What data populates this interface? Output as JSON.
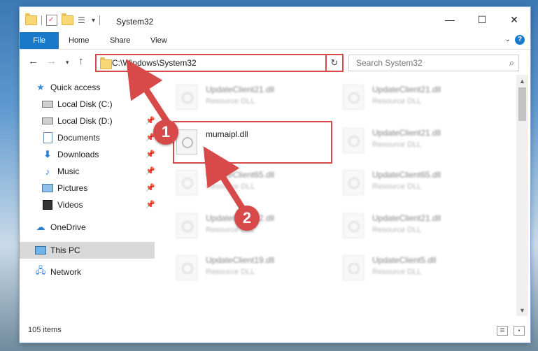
{
  "window": {
    "title": "System32",
    "controls": {
      "minimize": "—",
      "maximize": "☐",
      "close": "✕"
    }
  },
  "ribbon": {
    "file_label": "File",
    "tabs": [
      {
        "label": "Home"
      },
      {
        "label": "Share"
      },
      {
        "label": "View"
      }
    ]
  },
  "navbar": {
    "address": "C:\\Windows\\System32",
    "search_placeholder": "Search System32"
  },
  "sidebar": {
    "quick_access": "Quick access",
    "items": [
      {
        "label": "Local Disk (C:)",
        "icon": "drive-icon",
        "pinned": false
      },
      {
        "label": "Local Disk (D:)",
        "icon": "drive-icon",
        "pinned": true
      },
      {
        "label": "Documents",
        "icon": "documents-icon",
        "pinned": true
      },
      {
        "label": "Downloads",
        "icon": "download-icon",
        "pinned": true
      },
      {
        "label": "Music",
        "icon": "music-icon",
        "pinned": true
      },
      {
        "label": "Pictures",
        "icon": "pictures-icon",
        "pinned": true
      },
      {
        "label": "Videos",
        "icon": "videos-icon",
        "pinned": true
      }
    ],
    "onedrive": "OneDrive",
    "this_pc": "This PC",
    "network": "Network"
  },
  "files": {
    "left": [
      {
        "name": "UpdateClient21.dll",
        "type": "Resource DLL"
      },
      {
        "name": "mumaipl.dll",
        "type": ""
      },
      {
        "name": "UpdateClient65.dll",
        "type": "Resource DLL"
      },
      {
        "name": "UpdateClient42.dll",
        "type": "Resource DLL"
      },
      {
        "name": "UpdateClient19.dll",
        "type": "Resource DLL"
      }
    ],
    "right": [
      {
        "name": "UpdateClient21.dll",
        "type": "Resource DLL"
      },
      {
        "name": "UpdateClient21.dll",
        "type": "Resource DLL"
      },
      {
        "name": "UpdateClient65.dll",
        "type": "Resource DLL"
      },
      {
        "name": "UpdateClient21.dll",
        "type": "Resource DLL"
      },
      {
        "name": "UpdateClient5.dll",
        "type": "Resource DLL"
      }
    ]
  },
  "status": {
    "item_count": "105 items"
  },
  "annotations": {
    "step1": "1",
    "step2": "2"
  },
  "colors": {
    "accent": "#1979ca",
    "highlight": "#d84a4a",
    "selected_row": "#d9d9d9"
  }
}
